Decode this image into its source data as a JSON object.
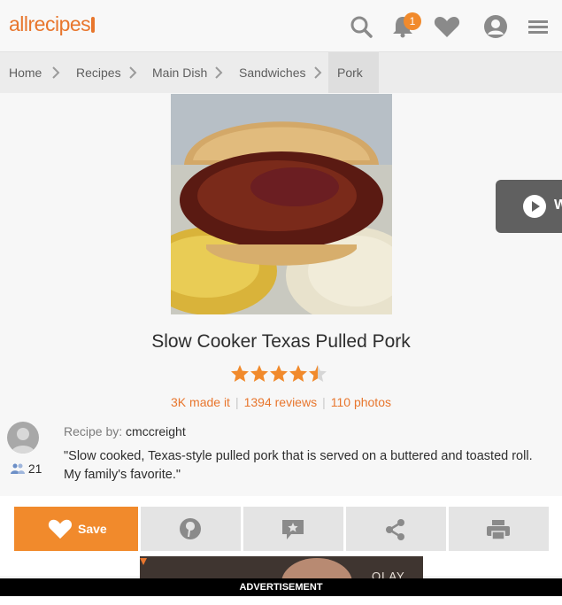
{
  "header": {
    "logo_text": "allrecipes",
    "notification_count": "1",
    "accent_color": "#f18a2c"
  },
  "breadcrumb": {
    "items": [
      "Home",
      "Recipes",
      "Main Dish",
      "Sandwiches",
      "Pork"
    ]
  },
  "video": {
    "label": "W"
  },
  "recipe": {
    "title": "Slow Cooker Texas Pulled Pork",
    "rating": 4.5,
    "rating_max": 5,
    "made_it": "3K made it",
    "reviews": "1394 reviews",
    "photos": "110 photos",
    "author_prefix": "Recipe by:",
    "author": "cmccreight",
    "followers": "21",
    "description": "\"Slow cooked, Texas-style pulled pork that is served on a buttered and toasted roll. My family's favorite.\""
  },
  "actions": {
    "save_label": "Save"
  },
  "ad": {
    "label": "ADVERTISEMENT",
    "partial_text": "OLAY"
  },
  "icons": [
    "search-icon",
    "bell-icon",
    "heart-icon",
    "profile-icon",
    "menu-icon",
    "chevron-right-icon",
    "play-icon",
    "star-icon",
    "pin-icon",
    "review-icon",
    "share-icon",
    "print-icon"
  ]
}
